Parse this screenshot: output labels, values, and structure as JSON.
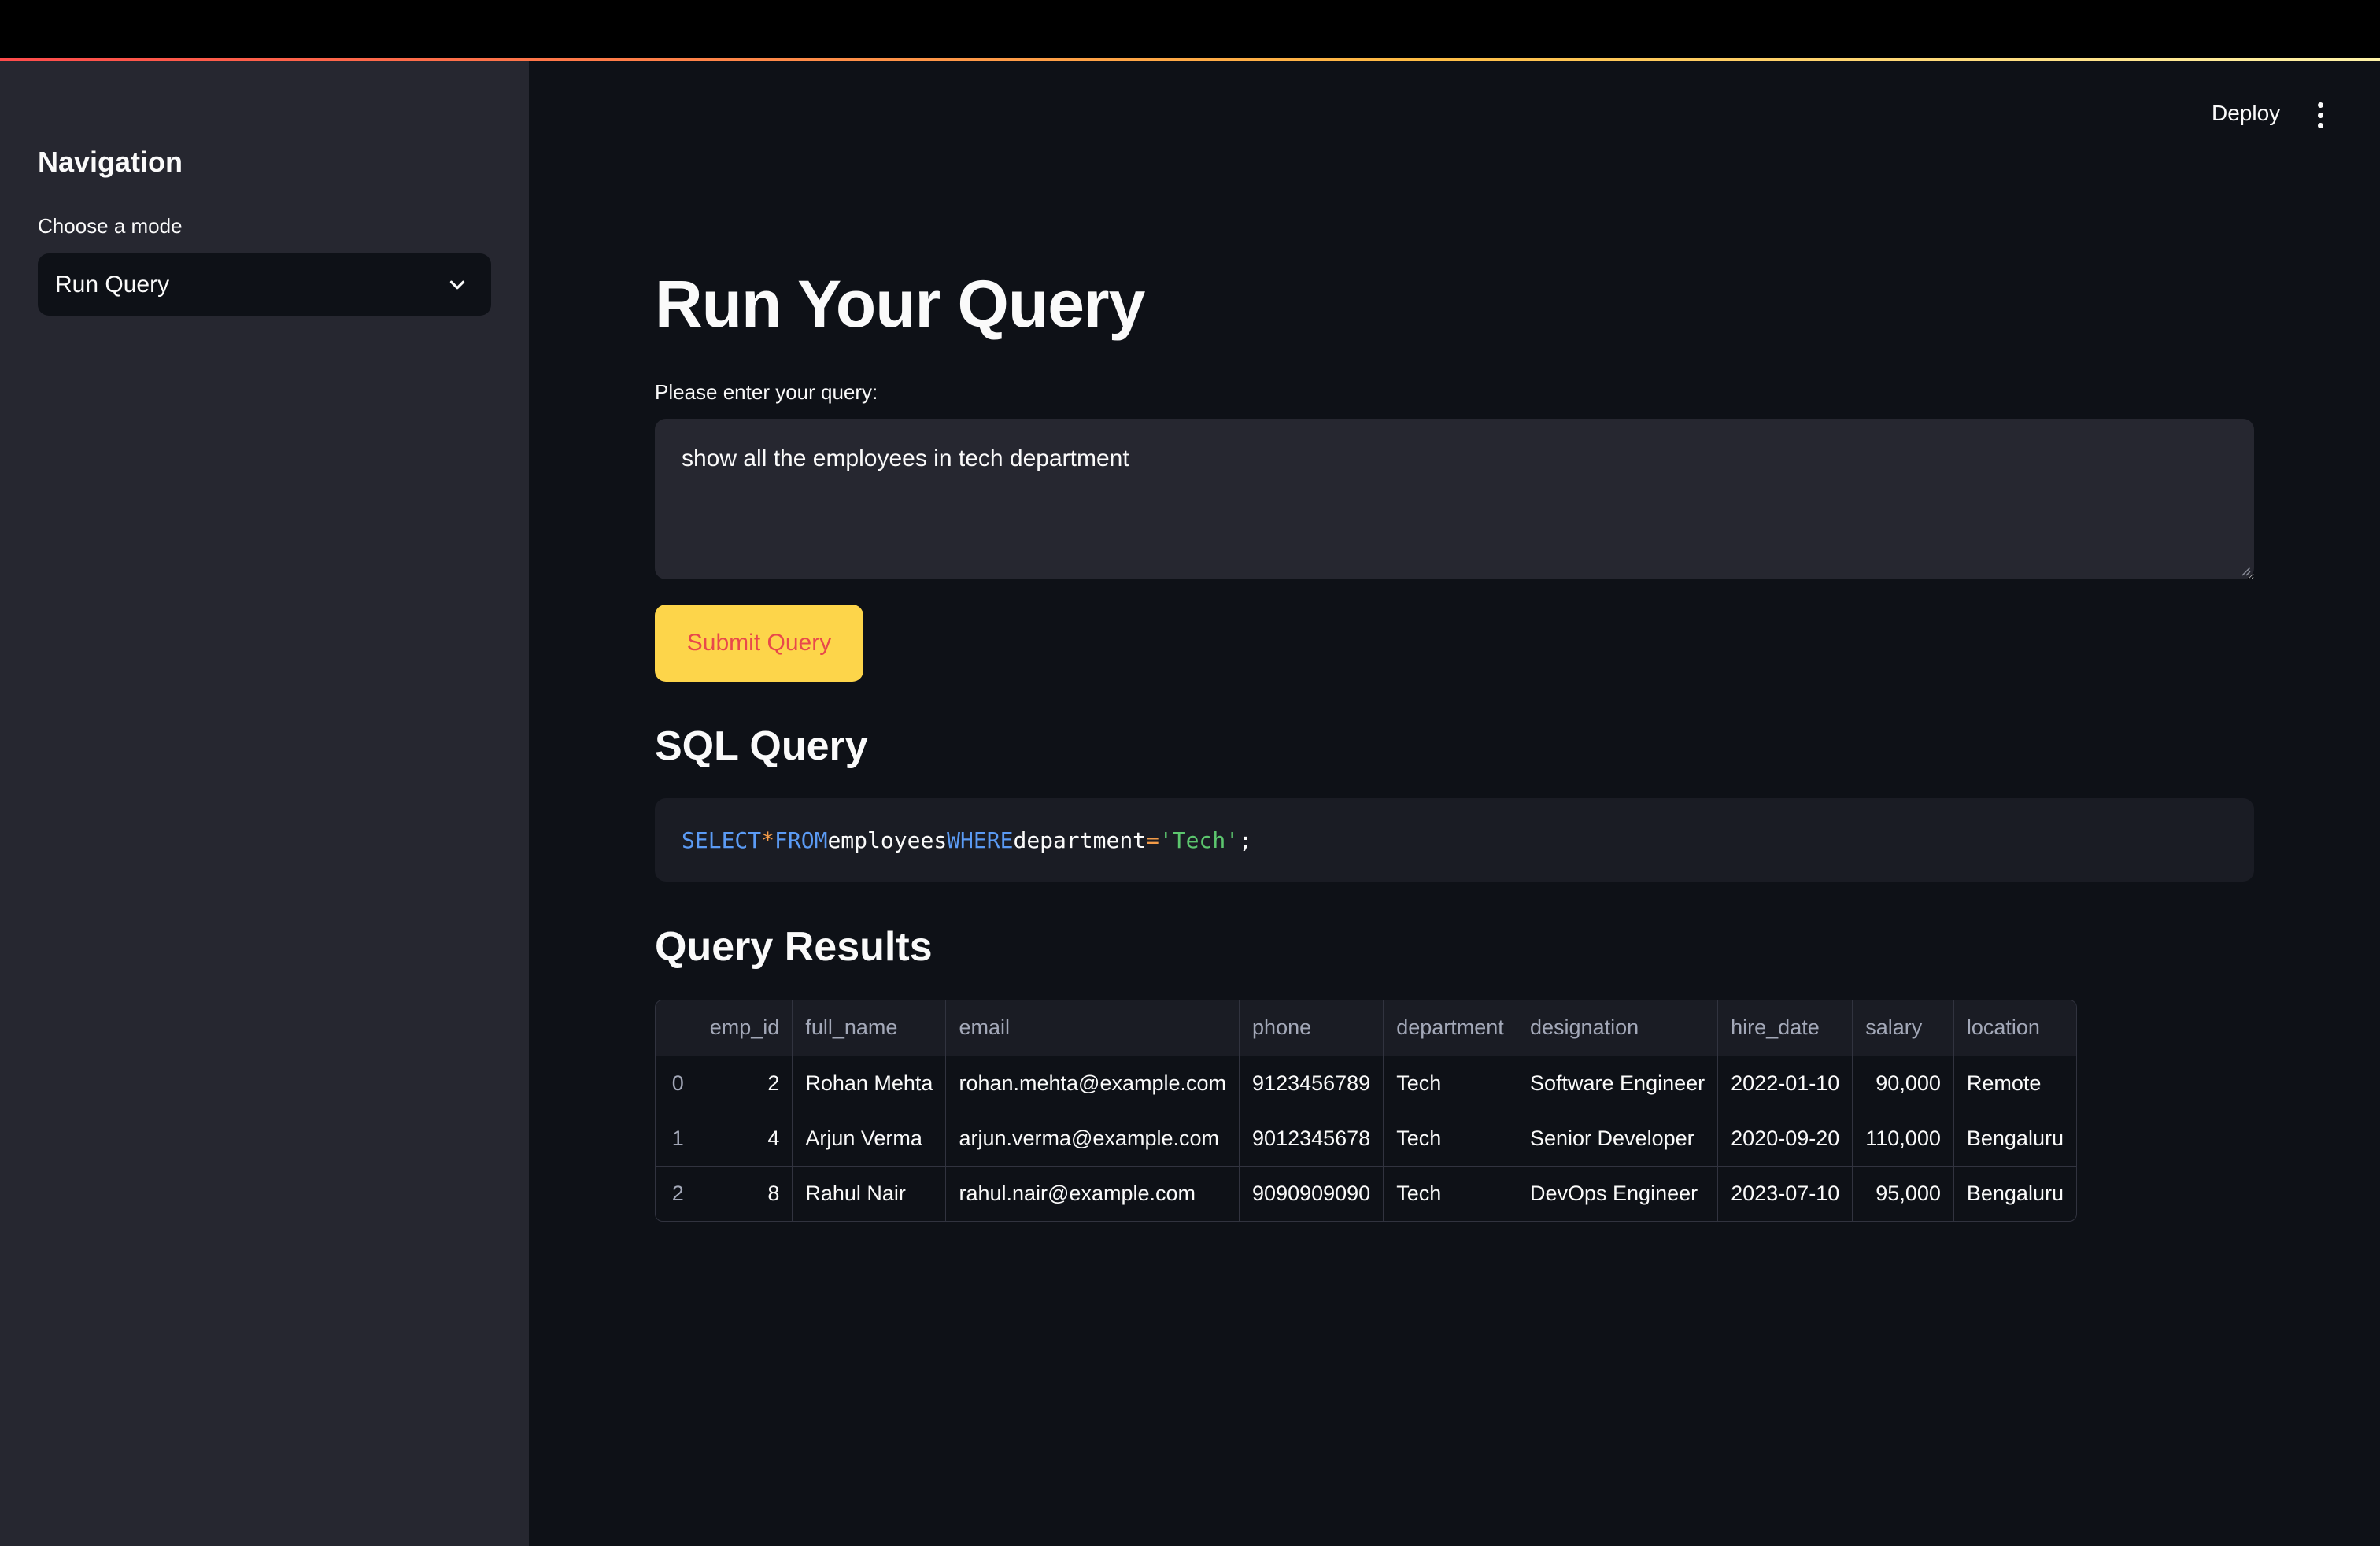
{
  "sidebar": {
    "title": "Navigation",
    "select_label": "Choose a mode",
    "select_value": "Run Query"
  },
  "header": {
    "deploy_label": "Deploy"
  },
  "main": {
    "title": "Run Your Query",
    "input_label": "Please enter your query:",
    "query_text": "show all the employees in tech department",
    "submit_label": "Submit Query",
    "sql_section_title": "SQL Query",
    "sql": {
      "select": "SELECT",
      "star": "*",
      "from": "FROM",
      "table": "employees",
      "where": "WHERE",
      "column": "department",
      "eq": "=",
      "value": "'Tech'",
      "semi": ";"
    },
    "results_title": "Query Results",
    "table": {
      "columns": [
        "",
        "emp_id",
        "full_name",
        "email",
        "phone",
        "department",
        "designation",
        "hire_date",
        "salary",
        "location"
      ],
      "rows": [
        [
          "0",
          "2",
          "Rohan Mehta",
          "rohan.mehta@example.com",
          "9123456789",
          "Tech",
          "Software Engineer",
          "2022-01-10",
          "90,000",
          "Remote"
        ],
        [
          "1",
          "4",
          "Arjun Verma",
          "arjun.verma@example.com",
          "9012345678",
          "Tech",
          "Senior Developer",
          "2020-09-20",
          "110,000",
          "Bengaluru"
        ],
        [
          "2",
          "8",
          "Rahul Nair",
          "rahul.nair@example.com",
          "9090909090",
          "Tech",
          "DevOps Engineer",
          "2023-07-10",
          "95,000",
          "Bengaluru"
        ]
      ]
    }
  },
  "colors": {
    "background": "#0e1117",
    "sidebar": "#262730",
    "accent_button": "#fdd54a",
    "button_text": "#e8484b"
  }
}
